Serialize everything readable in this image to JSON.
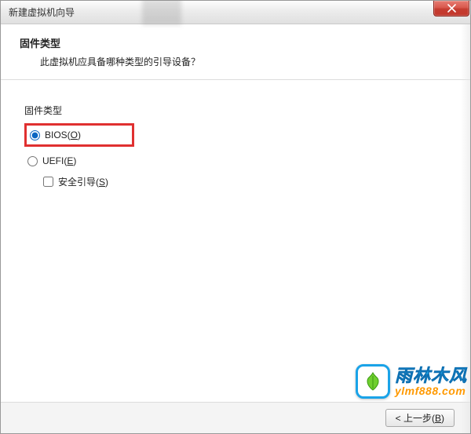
{
  "window": {
    "title": "新建虚拟机向导"
  },
  "header": {
    "title": "固件类型",
    "subtitle": "此虚拟机应具备哪种类型的引导设备？"
  },
  "group": {
    "label": "固件类型",
    "options": {
      "bios": {
        "label": "BIOS(",
        "mnemonic": "O",
        "suffix": ")",
        "selected": true
      },
      "uefi": {
        "label": "UEFI(",
        "mnemonic": "E",
        "suffix": ")",
        "selected": false
      }
    },
    "secureBoot": {
      "label": "安全引导(",
      "mnemonic": "S",
      "suffix": ")",
      "checked": false
    }
  },
  "buttons": {
    "back": {
      "label": "< 上一步(",
      "mnemonic": "B",
      "suffix": ")"
    }
  },
  "watermark": {
    "brand": "雨林木风",
    "url": "ylmf888.com"
  }
}
